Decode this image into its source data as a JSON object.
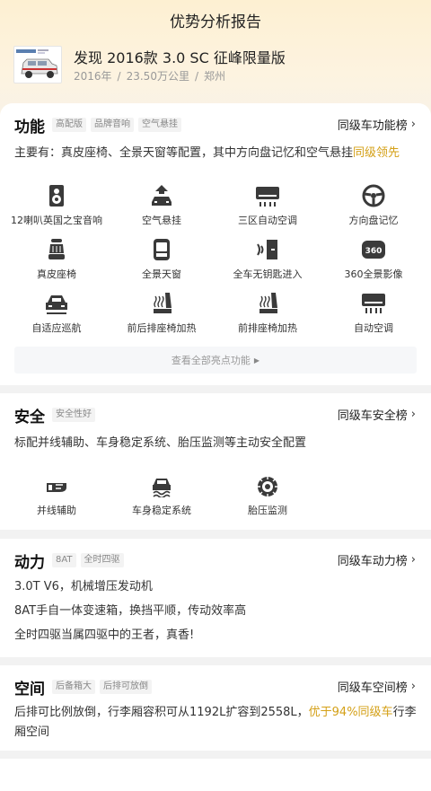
{
  "header": {
    "title": "优势分析报告",
    "car_name": "发现 2016款 3.0 SC 征峰限量版",
    "year": "2016年",
    "mileage": "23.50万公里",
    "city": "郑州",
    "separator": "/"
  },
  "features": {
    "title": "功能",
    "tags": [
      "高配版",
      "品牌音响",
      "空气悬挂"
    ],
    "rank_link": "同级车功能榜",
    "desc_main": "主要有：真皮座椅、全景天窗等配置，其中方向盘记忆和空气悬挂",
    "desc_highlight": "同级领先",
    "items": [
      {
        "label": "12喇叭英国之宝音响",
        "icon": "speaker-icon"
      },
      {
        "label": "空气悬挂",
        "icon": "air-suspension-icon"
      },
      {
        "label": "三区自动空调",
        "icon": "air-conditioner-icon"
      },
      {
        "label": "方向盘记忆",
        "icon": "steering-wheel-icon"
      },
      {
        "label": "真皮座椅",
        "icon": "leather-seat-icon"
      },
      {
        "label": "全景天窗",
        "icon": "sunroof-icon"
      },
      {
        "label": "全车无钥匙进入",
        "icon": "keyless-entry-icon"
      },
      {
        "label": "360全景影像",
        "icon": "camera-360-icon"
      },
      {
        "label": "自适应巡航",
        "icon": "adaptive-cruise-icon"
      },
      {
        "label": "前后排座椅加热",
        "icon": "seat-heating-icon"
      },
      {
        "label": "前排座椅加热",
        "icon": "front-seat-heating-icon"
      },
      {
        "label": "自动空调",
        "icon": "auto-ac-icon"
      }
    ],
    "see_all": "查看全部亮点功能"
  },
  "safety": {
    "title": "安全",
    "tags": [
      "安全性好"
    ],
    "rank_link": "同级车安全榜",
    "desc": "标配并线辅助、车身稳定系统、胎压监测等主动安全配置",
    "items": [
      {
        "label": "并线辅助",
        "icon": "lane-assist-icon"
      },
      {
        "label": "车身稳定系统",
        "icon": "stability-control-icon"
      },
      {
        "label": "胎压监测",
        "icon": "tire-pressure-icon"
      }
    ]
  },
  "power": {
    "title": "动力",
    "tags": [
      "8AT",
      "全时四驱"
    ],
    "rank_link": "同级车动力榜",
    "lines": [
      "3.0T V6，机械增压发动机",
      "8AT手自一体变速箱，换挡平顺，传动效率高",
      "全时四驱当属四驱中的王者，真香!"
    ]
  },
  "space": {
    "title": "空间",
    "tags": [
      "后备箱大",
      "后排可放倒"
    ],
    "rank_link": "同级车空间榜",
    "desc_main": "后排可比例放倒，行李厢容积可从1192L扩容到2558L，",
    "desc_highlight": "优于94%同级车",
    "desc_tail": "行李厢空间"
  },
  "colors": {
    "accent": "#d4a017",
    "hero_bg": "#fdf0d2",
    "icon_dark": "#3a3a3a"
  }
}
